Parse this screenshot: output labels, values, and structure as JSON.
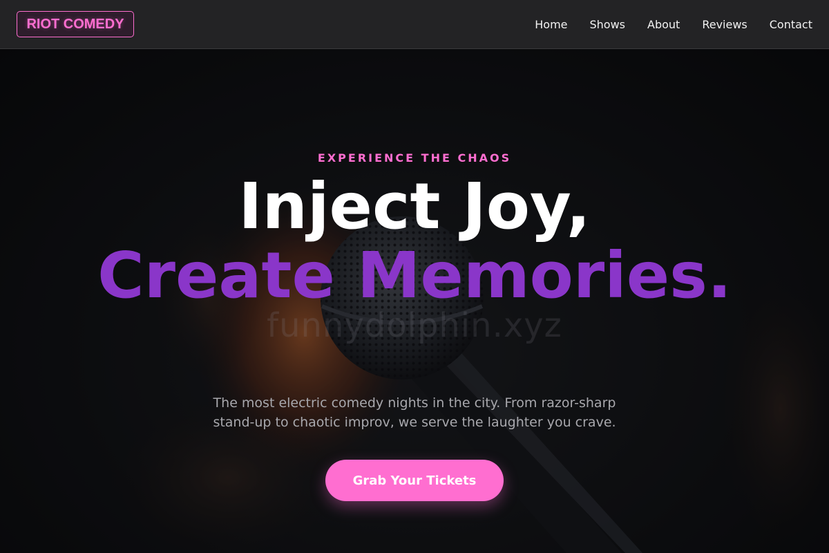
{
  "brand": {
    "logo_text": "RIOT COMEDY",
    "accent_color": "#ff6ed0"
  },
  "nav": {
    "links": [
      {
        "label": "Home"
      },
      {
        "label": "Shows"
      },
      {
        "label": "About"
      },
      {
        "label": "Reviews"
      },
      {
        "label": "Contact"
      }
    ]
  },
  "hero": {
    "eyebrow": "EXPERIENCE THE CHAOS",
    "headline_line1": "Inject Joy,",
    "headline_line2": "Create Memories.",
    "headline_line2_color": "#8a36c9",
    "watermark": "funnydolphin.xyz",
    "subtitle": "The most electric comedy nights in the city. From razor-sharp stand-up to chaotic improv, we serve the laughter you crave.",
    "cta_label": "Grab Your Tickets",
    "background_image": "microphone-photo"
  }
}
